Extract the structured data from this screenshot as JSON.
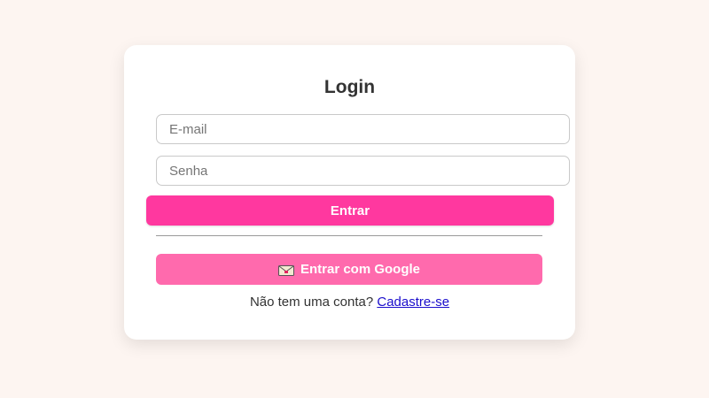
{
  "login": {
    "title": "Login",
    "email_placeholder": "E-mail",
    "password_placeholder": "Senha",
    "submit_label": "Entrar",
    "google_label": "Entrar com Google",
    "google_icon": "envelope-icon",
    "signup_prompt": "Não tem uma conta?",
    "signup_link": "Cadastre-se"
  },
  "colors": {
    "background": "#fdf5f1",
    "card": "#ffffff",
    "primary_button": "#ff389f",
    "google_button": "#ff6aad",
    "link": "#1a0dcc"
  }
}
